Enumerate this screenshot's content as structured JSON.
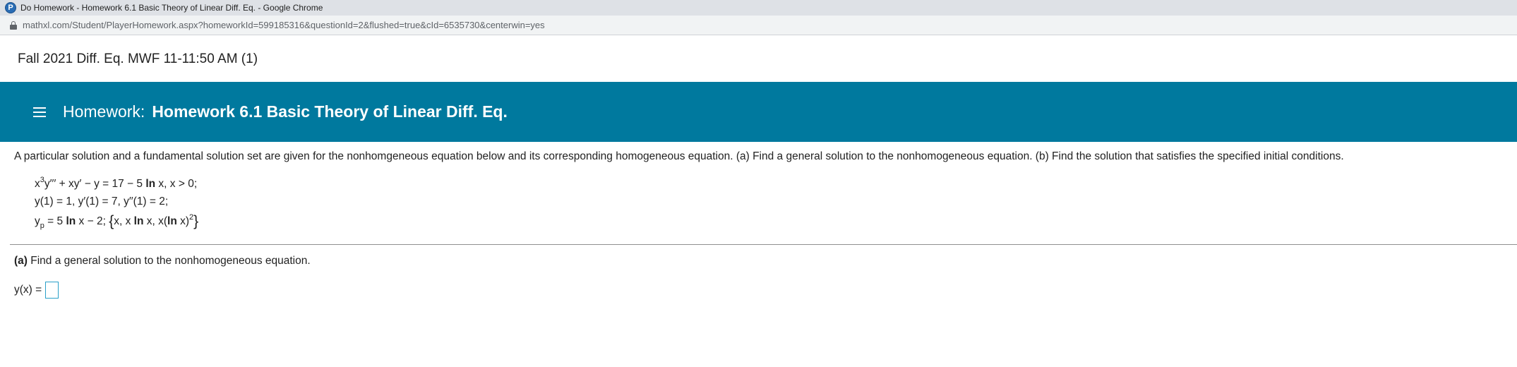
{
  "browser": {
    "window_title": "Do Homework - Homework 6.1 Basic Theory of Linear Diff. Eq. - Google Chrome",
    "url": "mathxl.com/Student/PlayerHomework.aspx?homeworkId=599185316&questionId=2&flushed=true&cId=6535730&centerwin=yes"
  },
  "course": {
    "name": "Fall 2021 Diff. Eq. MWF 11-11:50 AM (1)"
  },
  "homework": {
    "prefix": "Homework:",
    "title": "Homework 6.1 Basic Theory of Linear Diff. Eq.",
    "accent_color": "#00799e"
  },
  "question": {
    "prompt": "A particular solution and a fundamental solution set are given for the nonhomgeneous equation below and its corresponding homogeneous equation. (a) Find a general solution to the nonhomogeneous equation. (b) Find the solution that satisfies the specified initial conditions.",
    "equation": {
      "x": "x",
      "cube": "3",
      "rest_a": "y′′′ + xy′ − y = 17 − 5 ",
      "ln": "ln",
      "rest_b": " x, x > 0;"
    },
    "initial_conditions": "y(1) = 1, y′(1) = 7, y′′(1) = 2;",
    "particular": {
      "y": "y",
      "sub_p": "p",
      "eq_a": " = 5 ",
      "ln": "ln",
      "eq_b": " x − 2; ",
      "brace_open": "{",
      "set_a": "x, x ",
      "ln2": "ln",
      "set_b": " x, x(",
      "ln3": "ln",
      "set_c": " x)",
      "square": "2",
      "brace_close": "}"
    },
    "part_a": {
      "label": "(a)",
      "text": " Find a general solution to the nonhomogeneous equation."
    },
    "answer_label": "y(x) =",
    "answer_value": ""
  }
}
